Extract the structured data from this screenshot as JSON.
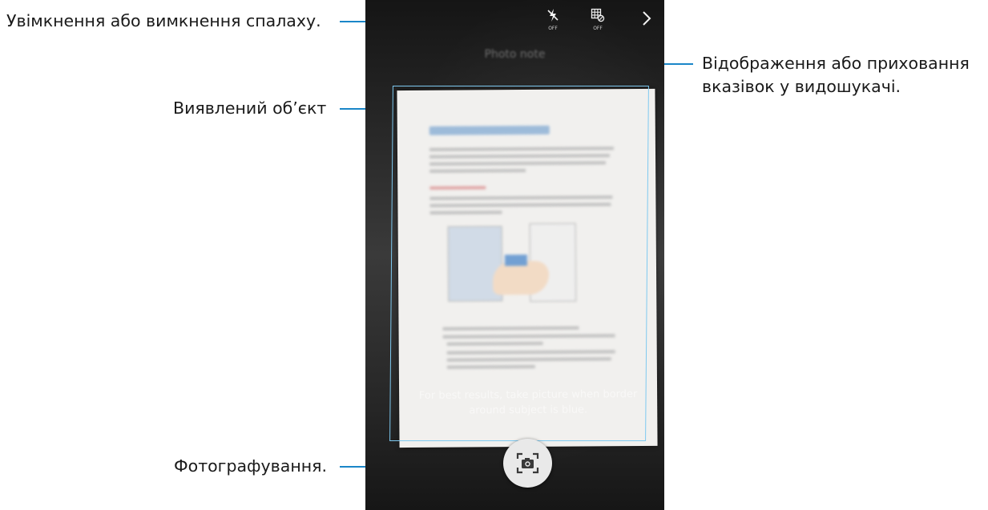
{
  "callouts": {
    "flash": "Увімкнення або вимкнення спалаху.",
    "guide_line1": "Відображення або приховання",
    "guide_line2": "вказівок у видошукачі.",
    "detected": "Виявлений об’єкт",
    "capture": "Фотографування."
  },
  "camera": {
    "mode_title": "Photo note",
    "flash_state": "OFF",
    "guide_state": "OFF",
    "next_symbol": ">",
    "hint": "For best results, take picture when border around subject is blue.",
    "document_heading": "S Pen button gestures"
  },
  "icons": {
    "flash": "flash-off-icon",
    "guide": "guide-grid-icon",
    "next": "chevron-right-icon",
    "capture": "camera-icon"
  },
  "colors": {
    "callout_line": "#1a86c8",
    "detect_frame": "#7ec9f0"
  }
}
